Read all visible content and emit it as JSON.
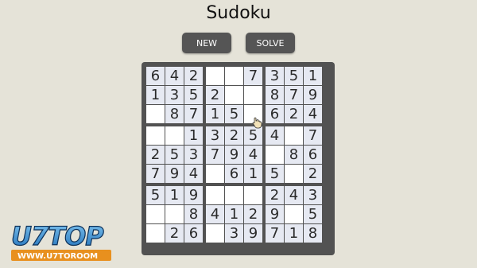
{
  "title": "Sudoku",
  "buttons": {
    "new": "NEW",
    "solve": "SOLVE"
  },
  "board": {
    "rows": [
      [
        "6",
        "4",
        "2",
        "",
        "",
        "7",
        "3",
        "5",
        "1"
      ],
      [
        "1",
        "3",
        "5",
        "2",
        "",
        "",
        "8",
        "7",
        "9"
      ],
      [
        "",
        "8",
        "7",
        "1",
        "5",
        "",
        "6",
        "2",
        "4"
      ],
      [
        "",
        "",
        "1",
        "3",
        "2",
        "5",
        "4",
        "",
        "7"
      ],
      [
        "2",
        "5",
        "3",
        "7",
        "9",
        "4",
        "",
        "8",
        "6"
      ],
      [
        "7",
        "9",
        "4",
        "",
        "6",
        "1",
        "5",
        "",
        "2"
      ],
      [
        "5",
        "1",
        "9",
        "",
        "",
        "",
        "2",
        "4",
        "3"
      ],
      [
        "",
        "",
        "8",
        "4",
        "1",
        "2",
        "9",
        "",
        "5"
      ],
      [
        "",
        "2",
        "6",
        "",
        "3",
        "9",
        "7",
        "1",
        "8"
      ]
    ]
  },
  "watermark": {
    "brand": "U7TOP",
    "url": "WWW.U7TOROOM"
  },
  "colors": {
    "background": "#e5e3d8",
    "button": "#555555",
    "grid": "#525252",
    "cell_filled": "#e6e9f2",
    "cell_empty": "#ffffff"
  }
}
